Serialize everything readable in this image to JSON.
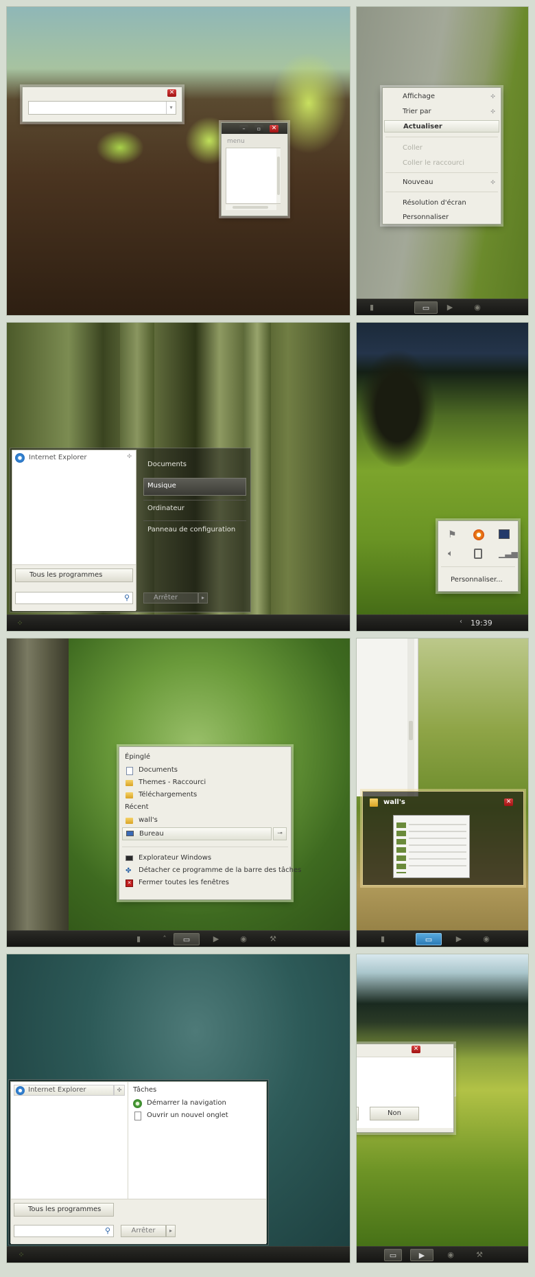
{
  "colors": {
    "accent": "#c8d8a8",
    "close": "#c01e1e",
    "taskbar": "#1c1c1a",
    "menu_bg": "#efeee6"
  },
  "panel1": {
    "menu_window": {
      "title": "menu"
    }
  },
  "panel2": {
    "context_menu": [
      {
        "label": "Affichage",
        "submenu": true,
        "state": "normal"
      },
      {
        "label": "Trier par",
        "submenu": true,
        "state": "normal"
      },
      {
        "label": "Actualiser",
        "submenu": false,
        "state": "highlighted"
      },
      {
        "label": "Coller",
        "submenu": false,
        "state": "disabled"
      },
      {
        "label": "Coller le raccourci",
        "submenu": false,
        "state": "disabled"
      },
      {
        "label": "Nouveau",
        "submenu": true,
        "state": "normal"
      },
      {
        "label": "Résolution d'écran",
        "submenu": false,
        "state": "normal"
      },
      {
        "label": "Personnaliser",
        "submenu": false,
        "state": "normal"
      }
    ]
  },
  "panel3": {
    "pinned": "Internet Explorer",
    "all_programs": "Tous les programmes",
    "right_items": [
      "Documents",
      "Musique",
      "Ordinateur",
      "Panneau de configuration"
    ],
    "selected": "Musique",
    "shutdown": "Arrêter"
  },
  "panel4": {
    "personalize": "Personnaliser...",
    "clock": "19:39",
    "tray_icons": [
      "flag-icon",
      "orb-icon",
      "monitor-icon",
      "speaker-icon",
      "power-plug-icon",
      "signal-icon"
    ]
  },
  "panel5": {
    "pinned_header": "Épinglé",
    "pinned": [
      "Documents",
      "Themes - Raccourci",
      "Téléchargements"
    ],
    "recent_header": "Récent",
    "recent": [
      "wall's",
      "Bureau"
    ],
    "actions": [
      "Explorateur Windows",
      "Détacher ce programme de la barre des tâches",
      "Fermer toutes les fenêtres"
    ]
  },
  "panel6": {
    "preview_title": "wall's"
  },
  "panel7": {
    "pinned": "Internet Explorer",
    "tasks_header": "Tâches",
    "tasks": [
      "Démarrer la navigation",
      "Ouvrir un nouvel onglet"
    ],
    "all_programs": "Tous les programmes",
    "shutdown": "Arrêter"
  },
  "panel8": {
    "no_button": "Non"
  }
}
